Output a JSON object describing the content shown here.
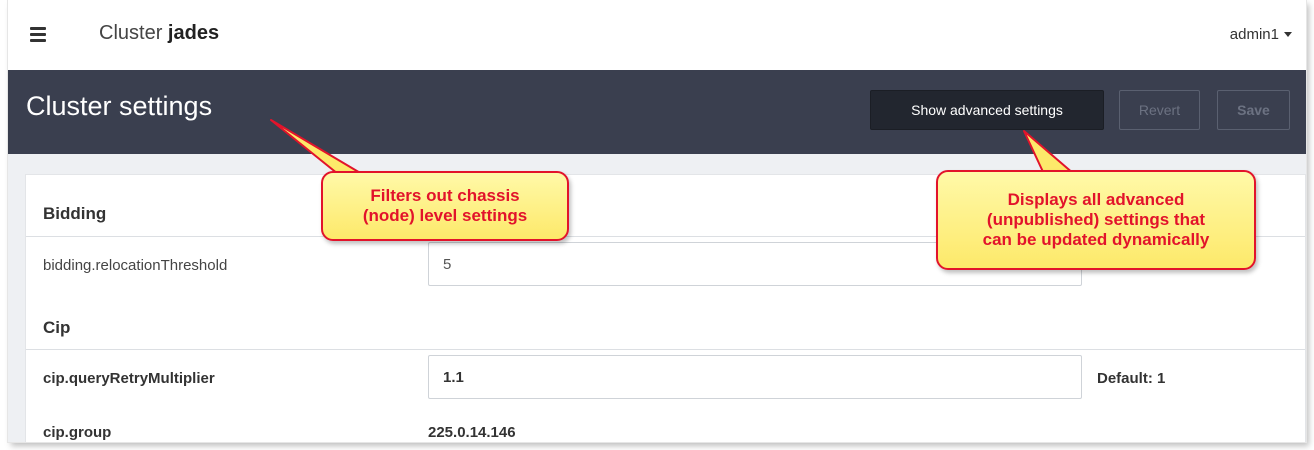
{
  "topbar": {
    "menu_icon": "hamburger-menu-icon",
    "cluster_prefix": "Cluster",
    "cluster_name": "jades",
    "user": "admin1",
    "user_icon": "caret-down-icon"
  },
  "header": {
    "title": "Cluster settings",
    "show_advanced_label": "Show advanced settings",
    "revert_label": "Revert",
    "save_label": "Save"
  },
  "sections": {
    "bidding": {
      "title": "Bidding",
      "setting_name": "bidding.relocationThreshold",
      "setting_value": "5"
    },
    "cip": {
      "title": "Cip",
      "retry_name": "cip.queryRetryMultiplier",
      "retry_value": "1.1",
      "retry_default": "Default: 1",
      "group_name": "cip.group",
      "group_value": "225.0.14.146"
    }
  },
  "callouts": {
    "filters": [
      "Filters out chassis",
      "(node) level settings"
    ],
    "advanced": [
      "Displays all advanced",
      "(unpublished) settings that",
      "can be updated dynamically"
    ]
  },
  "colors": {
    "header_bg": "#3a3f4f",
    "primary_button": "#22262f",
    "callout_fill": "#fde96a",
    "callout_border": "#e2132b"
  }
}
